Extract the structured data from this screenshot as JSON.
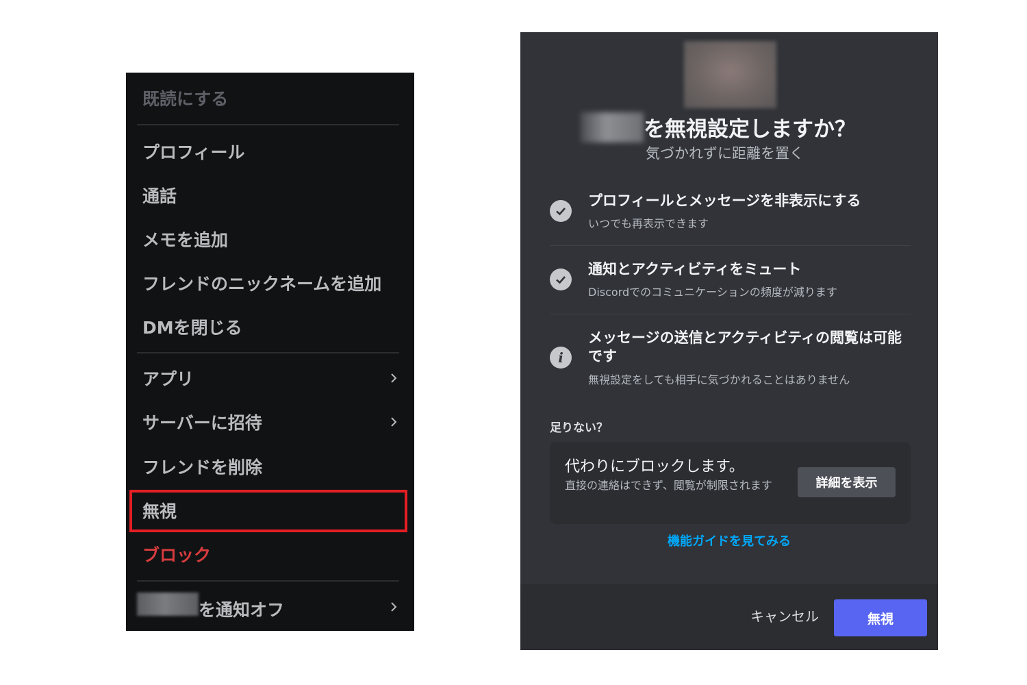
{
  "context_menu": {
    "mark_read": "既読にする",
    "profile": "プロフィール",
    "call": "通話",
    "add_note": "メモを追加",
    "add_friend_nickname": "フレンドのニックネームを追加",
    "close_dm": "DMを閉じる",
    "apps": "アプリ",
    "invite_to_server": "サーバーに招待",
    "remove_friend": "フレンドを削除",
    "ignore": "無視",
    "block": "ブロック",
    "mute_suffix": "を通知オフ"
  },
  "modal": {
    "title": "を無視設定しますか？",
    "subtitle": "気づかれずに距離を置く",
    "features": [
      {
        "icon": "check-circle-icon",
        "title": "プロフィールとメッセージを非表示にする",
        "desc": "いつでも再表示できます"
      },
      {
        "icon": "check-circle-icon",
        "title": "通知とアクティビティをミュート",
        "desc": "Discordでのコミュニケーションの頻度が減ります"
      },
      {
        "icon": "info-circle-icon",
        "title": "メッセージの送信とアクティビティの閲覧は可能です",
        "desc": "無視設定をしても相手に気づかれることはありません"
      }
    ],
    "not_enough": "足りない？",
    "block_card": {
      "title": "代わりにブロックします。",
      "desc": "直接の連絡はできず、閲覧が制限されます",
      "button": "詳細を表示"
    },
    "guide_link": "機能ガイドを見てみる",
    "cancel": "キャンセル",
    "confirm": "無視"
  },
  "colors": {
    "menu_bg": "#111214",
    "modal_bg": "#313338",
    "danger": "#d83c3e",
    "highlight_border": "#e31e24",
    "brand": "#5865f2",
    "link": "#00a8fc"
  }
}
